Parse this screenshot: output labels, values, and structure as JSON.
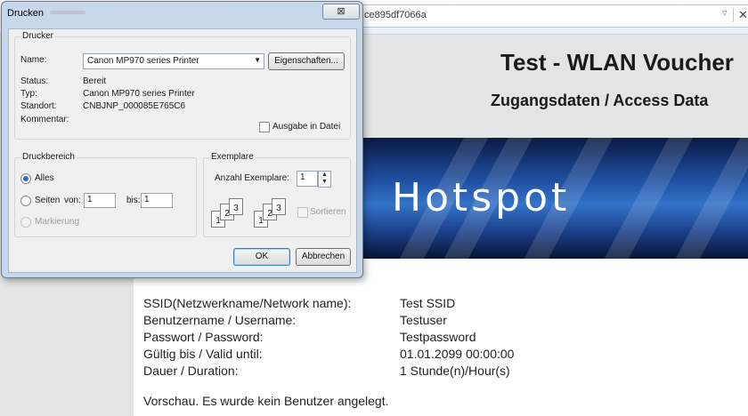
{
  "browser": {
    "url_fragment": "ce895df7066a",
    "dropdown_glyph": "▿",
    "close_glyph": "✕"
  },
  "page": {
    "title": "Test - WLAN Voucher",
    "subtitle": "Zugangsdaten / Access Data",
    "banner_text": "Hotspot",
    "rows": [
      {
        "label": "SSID(Netzwerkname/Network name):",
        "value": "Test SSID"
      },
      {
        "label": "Benutzername / Username:",
        "value": "Testuser"
      },
      {
        "label": "Passwort / Password:",
        "value": "Testpassword"
      },
      {
        "label": "Gültig bis / Valid until:",
        "value": "01.01.2099 00:00:00"
      },
      {
        "label": "Dauer / Duration:",
        "value": "1 Stunde(n)/Hour(s)"
      }
    ],
    "footer_note": "Vorschau. Es wurde kein Benutzer angelegt."
  },
  "dialog": {
    "title": "Drucken",
    "close_glyph": "⊠",
    "printer_group": {
      "legend": "Drucker",
      "name_label": "Name:",
      "name_value": "Canon MP970 series Printer",
      "properties_button": "Eigenschaften...",
      "status_label": "Status:",
      "status_value": "Bereit",
      "type_label": "Typ:",
      "type_value": "Canon MP970 series Printer",
      "location_label": "Standort:",
      "location_value": "CNBJNP_000085E765C6",
      "comment_label": "Kommentar:",
      "print_to_file_label": "Ausgabe in Datei"
    },
    "range_group": {
      "legend": "Druckbereich",
      "all_label": "Alles",
      "pages_label": "Seiten",
      "from_label": "von:",
      "from_value": "1",
      "to_label": "bis:",
      "to_value": "1",
      "selection_label": "Markierung"
    },
    "copies_group": {
      "legend": "Exemplare",
      "count_label": "Anzahl Exemplare:",
      "count_value": "1",
      "collate_label": "Sortieren"
    },
    "ok_button": "OK",
    "cancel_button": "Abbrechen"
  },
  "colors": {
    "dialog_frame": "#c7d8ea",
    "banner_blue": "#1f4fa0",
    "page_grey": "#e4e4e4"
  }
}
